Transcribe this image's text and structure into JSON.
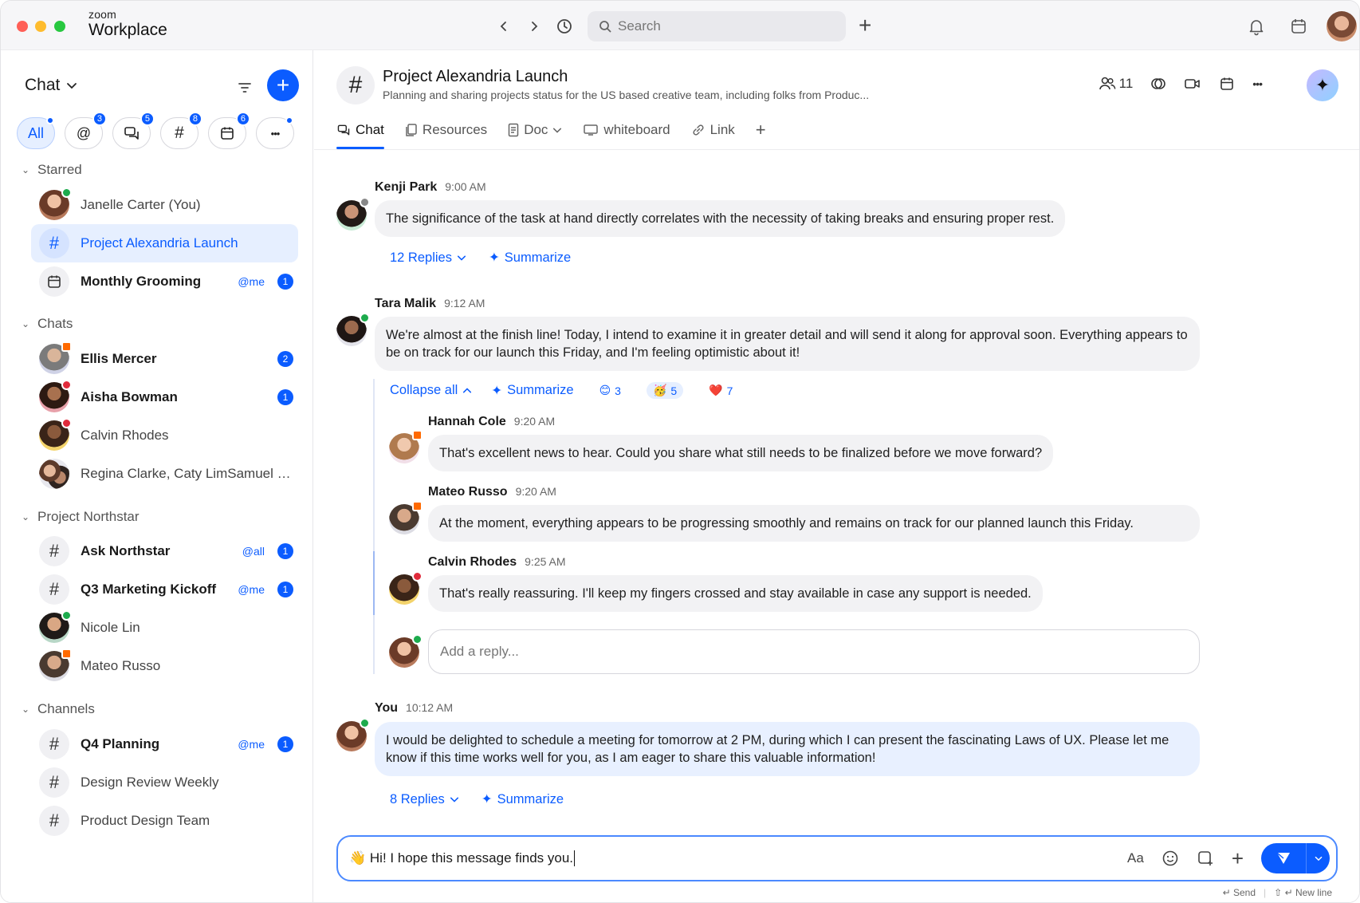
{
  "app": {
    "brand_top": "zoom",
    "brand_main": "Workplace",
    "search_placeholder": "Search"
  },
  "sidebar": {
    "title": "Chat",
    "filters": [
      {
        "label": "All",
        "active": true,
        "dot": true
      },
      {
        "icon": "at-icon",
        "glyph": "@",
        "badge": "3"
      },
      {
        "icon": "chat-bubbles-icon",
        "badge": "5"
      },
      {
        "icon": "hashtag-icon",
        "glyph": "#",
        "badge": "8"
      },
      {
        "icon": "calendar-icon",
        "badge": "6"
      },
      {
        "icon": "more-icon",
        "glyph": "•••",
        "dot": true
      }
    ],
    "sections": {
      "starred": "Starred",
      "chats": "Chats",
      "northstar": "Project Northstar",
      "channels": "Channels"
    },
    "items": {
      "janelle": {
        "label": "Janelle Carter (You)"
      },
      "alexandria": {
        "label": "Project Alexandria Launch"
      },
      "grooming": {
        "label": "Monthly Grooming",
        "mention": "@me",
        "count": "1"
      },
      "ellis": {
        "label": "Ellis Mercer",
        "count": "2"
      },
      "aisha": {
        "label": "Aisha Bowman",
        "count": "1"
      },
      "calvin": {
        "label": "Calvin Rhodes"
      },
      "regina": {
        "label": "Regina Clarke, Caty LimSamuel R..."
      },
      "ask_northstar": {
        "label": "Ask Northstar",
        "mention": "@all",
        "count": "1"
      },
      "q3_kickoff": {
        "label": "Q3 Marketing Kickoff",
        "mention": "@me",
        "count": "1"
      },
      "nicole": {
        "label": "Nicole Lin"
      },
      "mateo": {
        "label": "Mateo Russo"
      },
      "q4_planning": {
        "label": "Q4 Planning",
        "mention": "@me",
        "count": "1"
      },
      "design_review": {
        "label": "Design Review Weekly"
      },
      "product_design": {
        "label": "Product Design Team"
      }
    }
  },
  "channel": {
    "title": "Project Alexandria Launch",
    "description": "Planning and sharing projects status for the US based creative team, including folks from Produc...",
    "member_count": "11",
    "tabs": [
      "Chat",
      "Resources",
      "Doc",
      "whiteboard",
      "Link"
    ]
  },
  "messages": {
    "kenji": {
      "name": "Kenji Park",
      "time": "9:00 AM",
      "text": "The significance of the task at hand directly correlates with the necessity of taking breaks and ensuring proper rest.",
      "replies": "12 Replies",
      "summarize": "Summarize"
    },
    "tara": {
      "name": "Tara Malik",
      "time": "9:12 AM",
      "text": "We're almost at the finish line! Today, I intend to examine it in greater detail and will send it along for approval soon. Everything appears to be on track for our launch this Friday, and I'm feeling optimistic about it!",
      "collapse": "Collapse all",
      "summarize": "Summarize",
      "reactions": [
        {
          "emoji": "😊",
          "count": "3"
        },
        {
          "emoji": "🥳",
          "count": "5"
        },
        {
          "emoji": "❤️",
          "count": "7"
        }
      ]
    },
    "hannah": {
      "name": "Hannah Cole",
      "time": "9:20 AM",
      "text": "That's excellent news to hear. Could you share what still needs to be finalized before we move forward?"
    },
    "mateo": {
      "name": "Mateo Russo",
      "time": "9:20 AM",
      "text": "At the moment, everything appears to be progressing smoothly and remains on track for our planned launch this Friday."
    },
    "calvin": {
      "name": "Calvin Rhodes",
      "time": "9:25 AM",
      "text": "That's really reassuring. I'll keep my fingers crossed and stay available in case any support is needed."
    },
    "reply_placeholder": "Add a reply...",
    "you": {
      "name": "You",
      "time": "10:12 AM",
      "text": "I would be delighted to schedule a meeting for tomorrow at 2 PM, during which I can present the fascinating Laws of UX. Please let me know if this time works well for you, as I am eager to share this valuable information!",
      "replies": "8 Replies",
      "summarize": "Summarize"
    }
  },
  "composer": {
    "value": "👋 Hi! I hope this message finds you.",
    "format_label": "Aa",
    "hint_send": "Send",
    "hint_newline": "New line"
  }
}
